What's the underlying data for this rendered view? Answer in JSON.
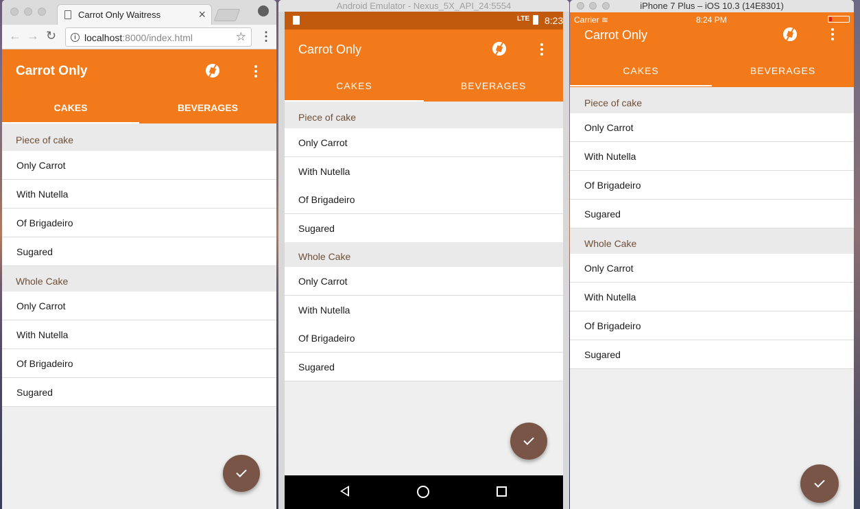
{
  "chrome": {
    "tab_title": "Carrot Only Waitress",
    "tab_close": "×",
    "url_host": "localhost",
    "url_rest": ":8000/index.html",
    "back": "←",
    "forward": "→",
    "reload": "↻",
    "star": "☆",
    "menu": "⋮",
    "info": "i"
  },
  "android": {
    "window_title": "Android Emulator - Nexus_5X_API_24:5554",
    "status_time": "8:23",
    "status_net": "LTE"
  },
  "ios": {
    "window_title": "iPhone 7 Plus – iOS 10.3 (14E8301)",
    "carrier": "Carrier ≋",
    "status_time": "8:24 PM"
  },
  "app": {
    "title": "Carrot Only",
    "tabs": [
      {
        "label": "CAKES",
        "selected": true
      },
      {
        "label": "BEVERAGES",
        "selected": false
      }
    ],
    "sections": [
      {
        "header": "Piece of cake",
        "items": [
          "Only Carrot",
          "With Nutella",
          "Of Brigadeiro",
          "Sugared"
        ]
      },
      {
        "header": "Whole Cake",
        "items": [
          "Only Carrot",
          "With Nutella",
          "Of Brigadeiro",
          "Sugared"
        ]
      }
    ],
    "colors": {
      "primary": "#f27a1a",
      "fab": "#795548",
      "section_text": "#6f4e37"
    },
    "icons": {
      "action": "camera-shutter-icon",
      "menu": "more-vert-icon",
      "fab": "check-icon"
    }
  }
}
